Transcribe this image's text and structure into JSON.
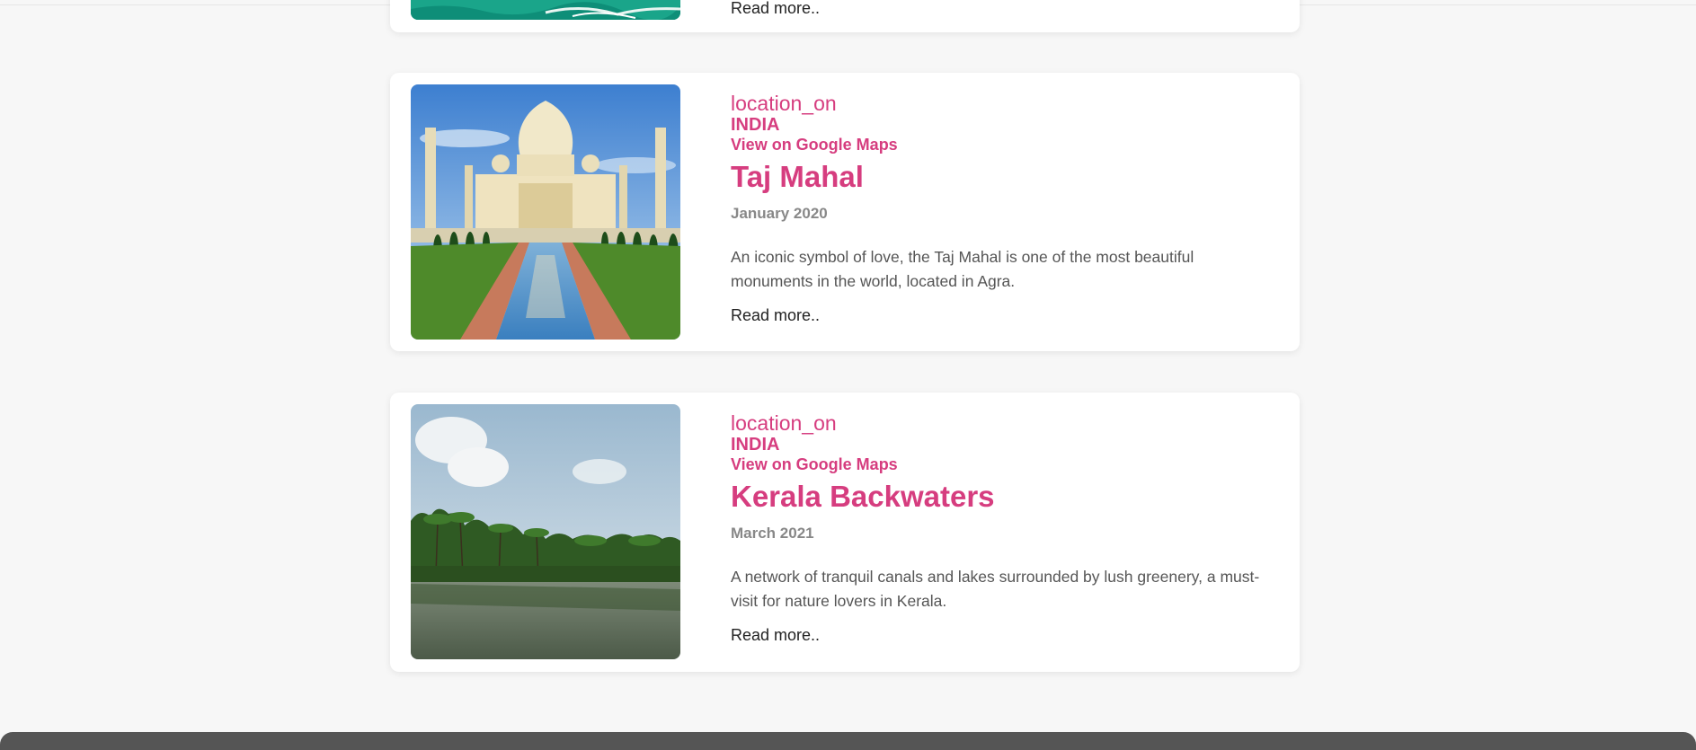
{
  "cards": [
    {
      "read_more": "Read more.."
    },
    {
      "icon_text": "location_on",
      "country": "INDIA",
      "maps_link": "View on Google Maps",
      "title": "Taj Mahal",
      "date": "January 2020",
      "description": "An iconic symbol of love, the Taj Mahal is one of the most beautiful monuments in the world, located in Agra.",
      "read_more": "Read more.."
    },
    {
      "icon_text": "location_on",
      "country": "INDIA",
      "maps_link": "View on Google Maps",
      "title": "Kerala Backwaters",
      "date": "March 2021",
      "description": "A network of tranquil canals and lakes surrounded by lush greenery, a must-visit for nature lovers in Kerala.",
      "read_more": "Read more.."
    }
  ],
  "colors": {
    "accent": "#d63d7f",
    "background": "#f7f7f7",
    "footer": "#555555"
  }
}
